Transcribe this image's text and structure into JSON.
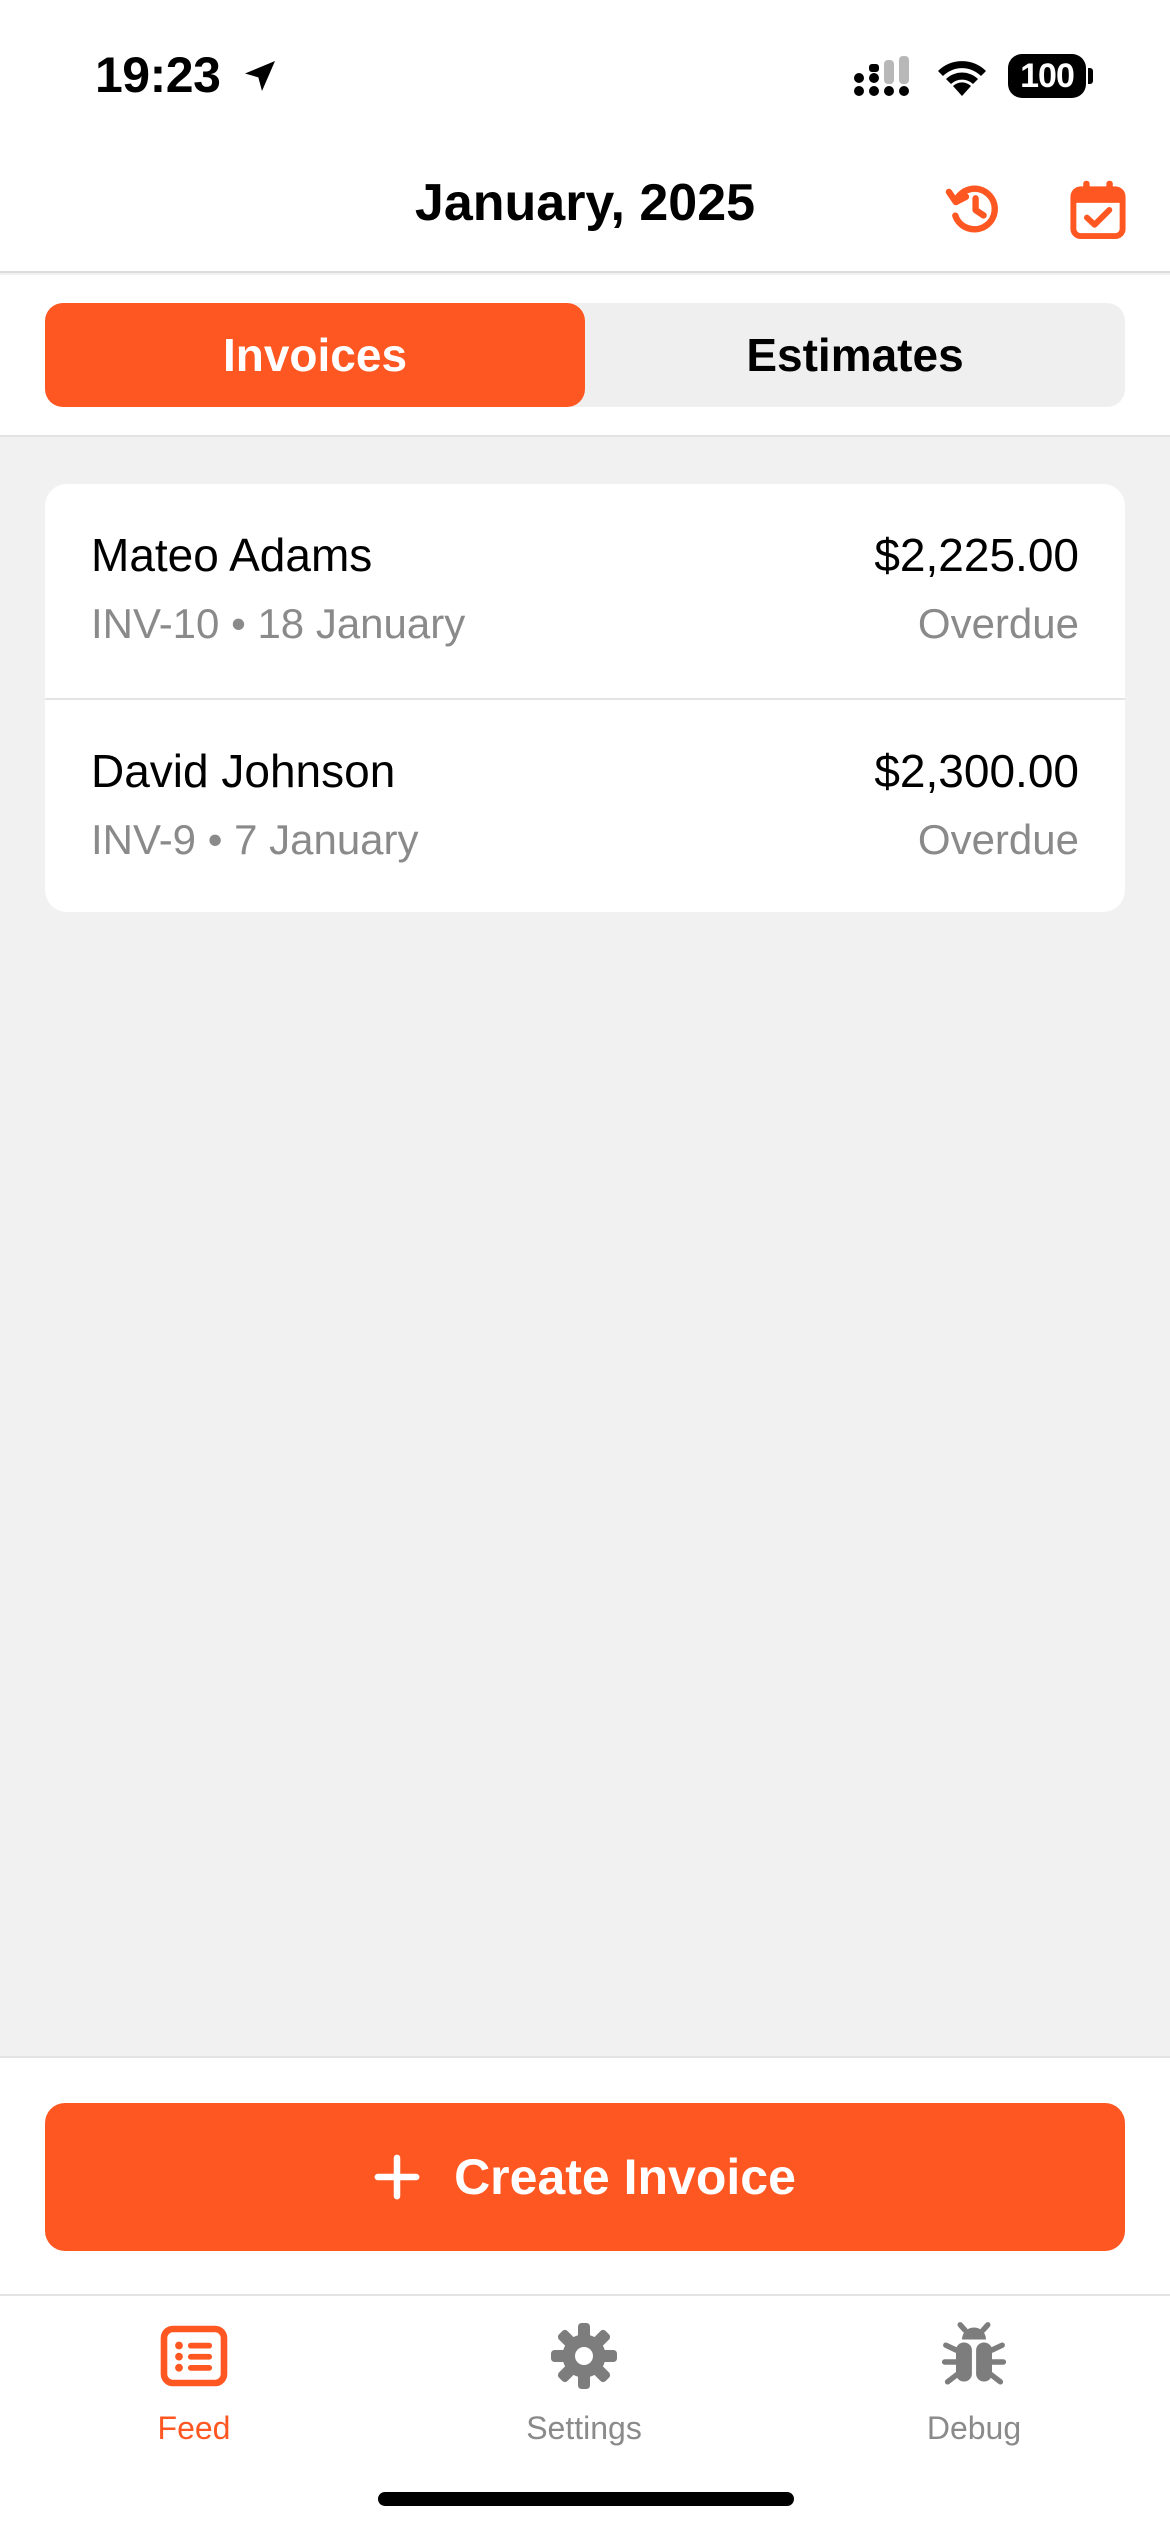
{
  "status_bar": {
    "time": "19:23",
    "battery": "100",
    "icons": [
      "location-arrow-icon",
      "cellular-signal-icon",
      "wifi-icon",
      "battery-icon"
    ]
  },
  "header": {
    "title": "January, 2025",
    "actions": [
      "history-icon",
      "calendar-check-icon"
    ]
  },
  "segments": {
    "invoices_label": "Invoices",
    "estimates_label": "Estimates",
    "selected": "Invoices"
  },
  "invoices": [
    {
      "client": "Mateo Adams",
      "number": "INV-10",
      "date": "18 January",
      "meta": "INV-10 • 18 January",
      "amount": "$2,225.00",
      "status": "Overdue"
    },
    {
      "client": "David Johnson",
      "number": "INV-9",
      "date": "7 January",
      "meta": "INV-9 • 7 January",
      "amount": "$2,300.00",
      "status": "Overdue"
    }
  ],
  "actions": {
    "create_label": "Create Invoice",
    "create_icon": "plus-icon"
  },
  "tab_bar": {
    "feed_label": "Feed",
    "settings_label": "Settings",
    "debug_label": "Debug",
    "active": "Feed"
  },
  "colors": {
    "accent": "#ff5722",
    "background": "#f1f1f1",
    "surface": "#ffffff",
    "secondary_text": "#8a8a8a"
  }
}
